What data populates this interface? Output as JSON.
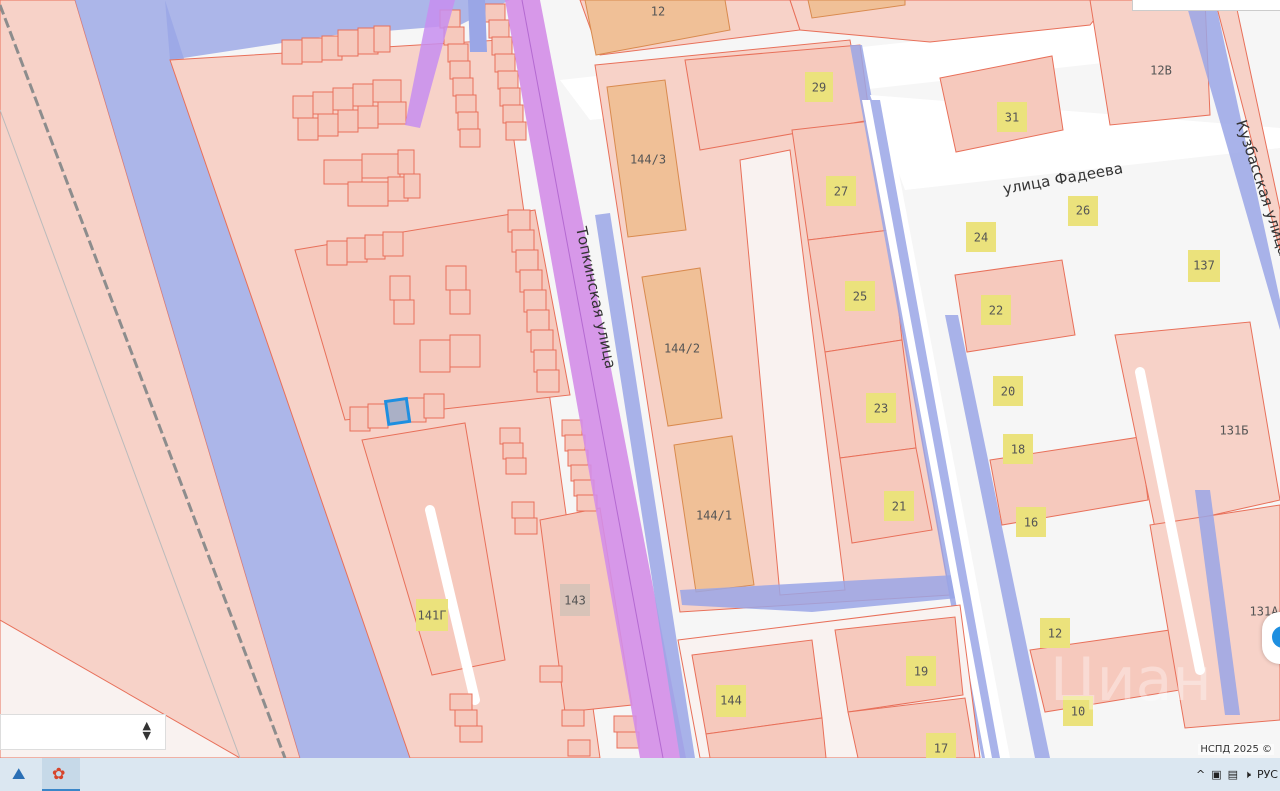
{
  "map": {
    "street_labels": {
      "topkinskaya": "Топкинская улица",
      "fadeeva": "улица Фадеева",
      "kuzbasskaya": "Кузбасская улица"
    },
    "building_labels": {
      "b12_top": "12",
      "b29": "29",
      "b12v": "12В",
      "b31": "31",
      "b144_3": "144/3",
      "b27": "27",
      "b26": "26",
      "b24": "24",
      "b137": "137",
      "b25": "25",
      "b22": "22",
      "b144_2": "144/2",
      "b20": "20",
      "b23": "23",
      "b131b": "131Б",
      "b18": "18",
      "b21": "21",
      "b144_1": "144/1",
      "b16": "16",
      "b141g": "141Г",
      "b143": "143",
      "b131a": "131А",
      "b12_bottom": "12",
      "b19": "19",
      "b144": "144",
      "b10": "10",
      "b17": "17"
    },
    "watermark": "Циан",
    "copyright": "НСПД 2025 ©"
  },
  "select_control": {
    "value": ""
  },
  "taskbar": {
    "apps": [
      {
        "icon": "ship-app-icon",
        "active": false
      },
      {
        "icon": "browser-app-icon",
        "active": true
      }
    ],
    "tray": {
      "chevron": "^",
      "language": "РУС"
    }
  },
  "colors": {
    "background": "#f6f6f6",
    "parcel_fill": "#f7d2c8",
    "parcel_stroke": "#e8705a",
    "building_fill": "#f0c097",
    "building_stroke": "#d98a4e",
    "road_zone": "#9aa6e6",
    "street_highlight": "#d48ee8",
    "label_badge": "#ebe27c",
    "taskbar": "#dbe7f1",
    "selected_parcel": "#1e8fe0"
  }
}
